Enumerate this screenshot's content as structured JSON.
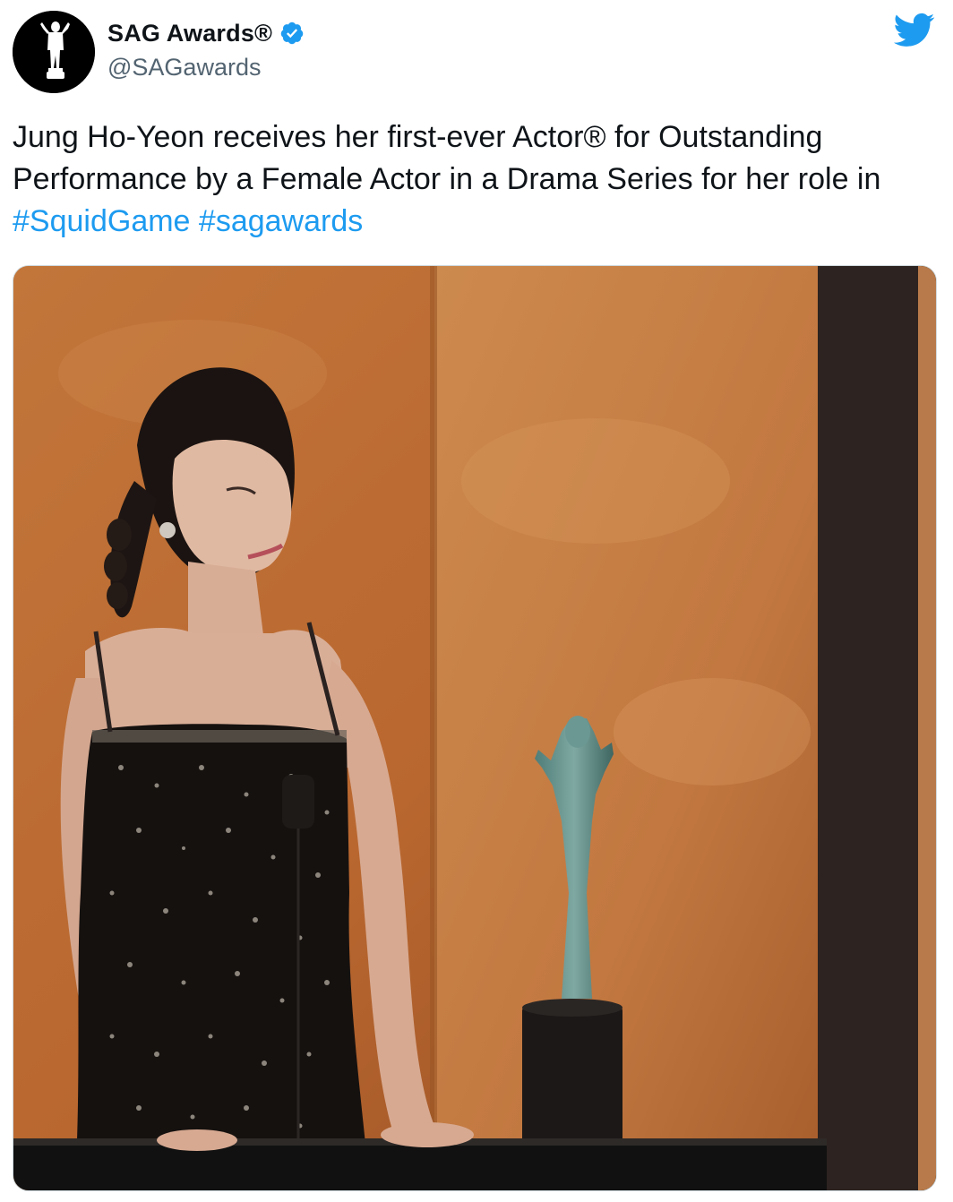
{
  "account": {
    "display_name": "SAG Awards®",
    "handle": "@SAGawards",
    "verified": true,
    "avatar_icon": "sag-actor-statuette-logo-icon"
  },
  "tweet": {
    "text_segments": [
      "Jung Ho-Yeon receives her first-ever Actor® for Outstanding Performance by a Female Actor in a Drama Series for her role in ",
      "#SquidGame",
      " ",
      "#sagawards"
    ]
  },
  "icons": {
    "brand": "twitter-bird-icon",
    "verified": "verified-badge-icon"
  },
  "colors": {
    "twitter_blue": "#1d9bf0",
    "text": "#0f1419",
    "handle_gray": "#536471"
  }
}
